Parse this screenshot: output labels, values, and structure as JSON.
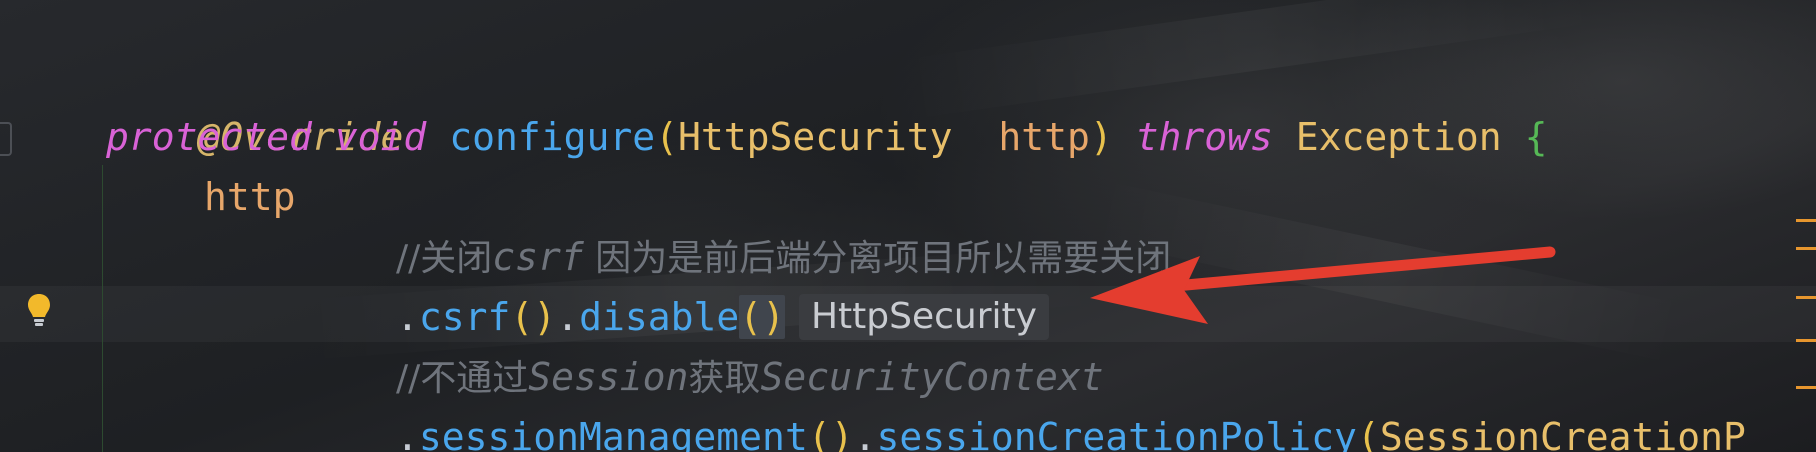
{
  "editor": {
    "lines": [
      {
        "annotation": "@Override"
      },
      {
        "kw_protected": "protected",
        "kw_void": "void",
        "method": "configure",
        "open_paren": "(",
        "param_type": "HttpSecurity",
        "param_name": "http",
        "close_paren": ")",
        "kw_throws": "throws",
        "exception": "Exception",
        "brace": "{"
      },
      {
        "receiver": "http"
      },
      {
        "comment_prefix": "//关闭",
        "comment_code": "csrf",
        "comment_suffix": " 因为是前后端分离项目所以需要关闭"
      },
      {
        "dot1": ".",
        "call1": "csrf",
        "paren1": "()",
        "dot2": ".",
        "call2": "disable",
        "paren2": "()",
        "type_hint": "HttpSecurity"
      },
      {
        "comment_prefix": "//不通过",
        "comment_code1": "Session",
        "comment_mid": "获取",
        "comment_code2": "SecurityContext"
      },
      {
        "dot1": ".",
        "call1": "sessionManagement",
        "paren1": "()",
        "dot2": ".",
        "call2": "sessionCreationPolicy",
        "open_paren": "(",
        "arg": "SessionCreationP"
      }
    ]
  },
  "icons": {
    "intention": "lightbulb-icon",
    "arrow": "red-arrow-annotation"
  },
  "colors": {
    "keyword": "#d962d6",
    "method": "#4aa6ec",
    "type": "#e8bf6a",
    "comment": "#6f747c",
    "arrow": "#e43d2f"
  }
}
